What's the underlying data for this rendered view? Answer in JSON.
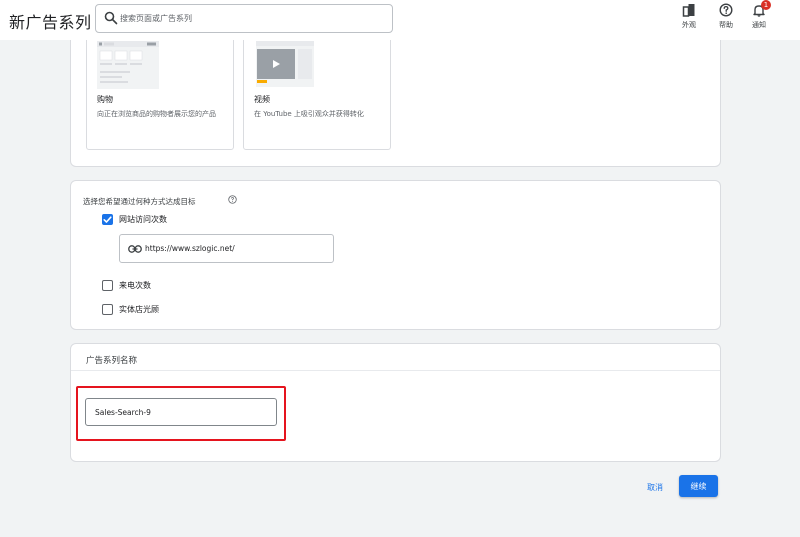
{
  "header": {
    "title": "新广告系列",
    "search_placeholder": "搜索页面或广告系列",
    "actions": [
      {
        "label": "外观",
        "icon": "appearance-icon"
      },
      {
        "label": "帮助",
        "icon": "help-icon"
      },
      {
        "label": "通知",
        "icon": "bell-icon",
        "badge": "1"
      }
    ]
  },
  "goal_types": [
    {
      "title": "购物",
      "description": "向正在浏览商品的购物者展示您的产品",
      "icon": "shopping-thumbnail"
    },
    {
      "title": "视频",
      "description": "在 YouTube 上吸引观众并获得转化",
      "icon": "video-thumbnail"
    }
  ],
  "reach_goal": {
    "question": "选择您希望通过何种方式达成目标",
    "options": [
      {
        "label": "网站访问次数",
        "checked": true
      },
      {
        "label": "来电次数",
        "checked": false
      },
      {
        "label": "实体店光顾",
        "checked": false
      }
    ],
    "website_url": "https://www.szlogic.net/"
  },
  "campaign_name": {
    "section_title": "广告系列名称",
    "value": "Sales-Search-9"
  },
  "footer": {
    "cancel_label": "取消",
    "continue_label": "继续"
  },
  "colors": {
    "accent": "#1a73e8",
    "highlight": "#e5141e",
    "badge": "#d93025",
    "background": "#f1f3f4"
  }
}
